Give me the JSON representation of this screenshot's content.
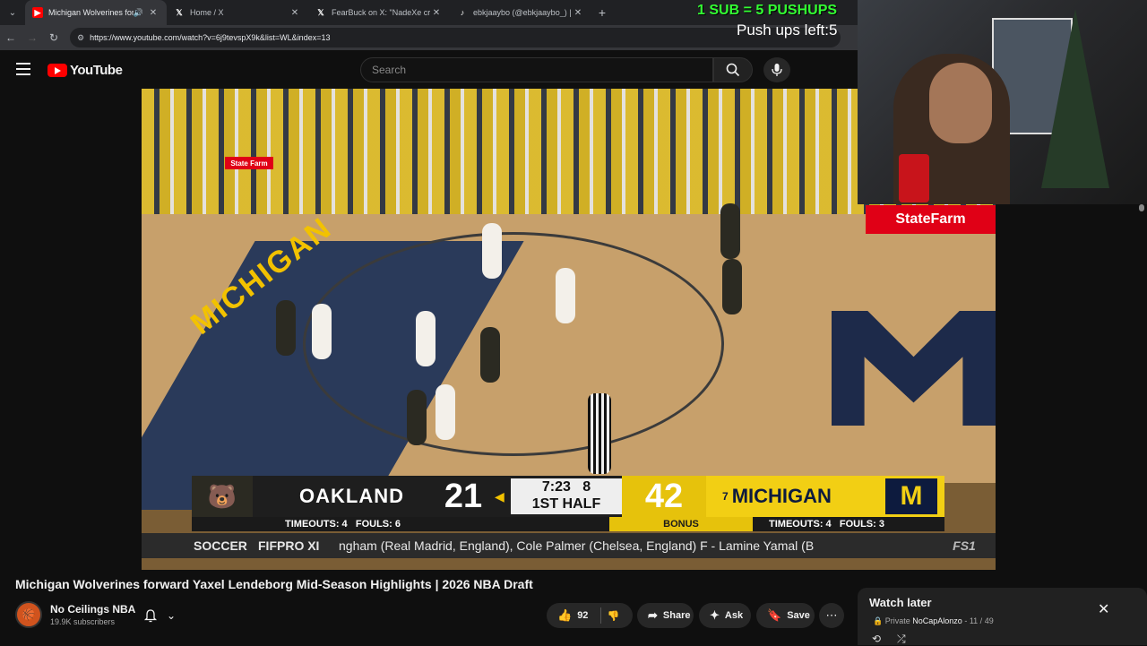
{
  "browser": {
    "tabs": [
      {
        "title": "Michigan Wolverines forwa",
        "icon": "youtube-icon",
        "active": true
      },
      {
        "title": "Home / X",
        "icon": "x-icon",
        "active": false
      },
      {
        "title": "FearBuck on X: \"NadeXe crashe",
        "icon": "x-icon",
        "active": false
      },
      {
        "title": "ebkjaaybo (@ebkjaaybo_) | Tik",
        "icon": "tiktok-icon",
        "active": false
      }
    ],
    "url": "https://www.youtube.com/watch?v=6j9tevspX9k&list=WL&index=13"
  },
  "youtube": {
    "logo_text": "YouTube",
    "search_placeholder": "Search"
  },
  "overlay": {
    "sub_banner": "1 SUB = 5 PUSHUPS",
    "pushups_left": "Push ups left:5"
  },
  "video": {
    "sponsor": "StateFarm",
    "sponsor_small": "State Farm",
    "court_text": "MICHIGAN",
    "scoreboard": {
      "away_team": "OAKLAND",
      "away_score": "21",
      "clock": "7:23",
      "shot_clock": "8",
      "period": "1ST HALF",
      "home_score": "42",
      "home_seed": "7",
      "home_team": "MICHIGAN",
      "away_timeouts": "TIMEOUTS: 4",
      "away_fouls": "FOULS: 6",
      "bonus": "BONUS",
      "home_timeouts": "TIMEOUTS: 4",
      "home_fouls": "FOULS: 3"
    },
    "ticker": {
      "sport": "SOCCER",
      "category": "FIFPRO XI",
      "text": "ngham (Real Madrid, England), Cole Palmer (Chelsea, England)   F - Lamine Yamal (B",
      "network": "FS1"
    }
  },
  "details": {
    "title": "Michigan Wolverines forward Yaxel Lendeborg Mid-Season Highlights | 2026 NBA Draft",
    "channel_name": "No Ceilings NBA",
    "subscribers": "19.9K subscribers",
    "likes": "92",
    "share_label": "Share",
    "ask_label": "Ask",
    "save_label": "Save"
  },
  "watch_later": {
    "title": "Watch later",
    "privacy": "Private",
    "owner": "NoCapAlonzo",
    "position": "11 / 49"
  },
  "colors": {
    "sub_banner": "#33ff33",
    "youtube_red": "#ff0000",
    "michigan_maize": "#f2cf14",
    "michigan_blue": "#0d1b3e"
  }
}
